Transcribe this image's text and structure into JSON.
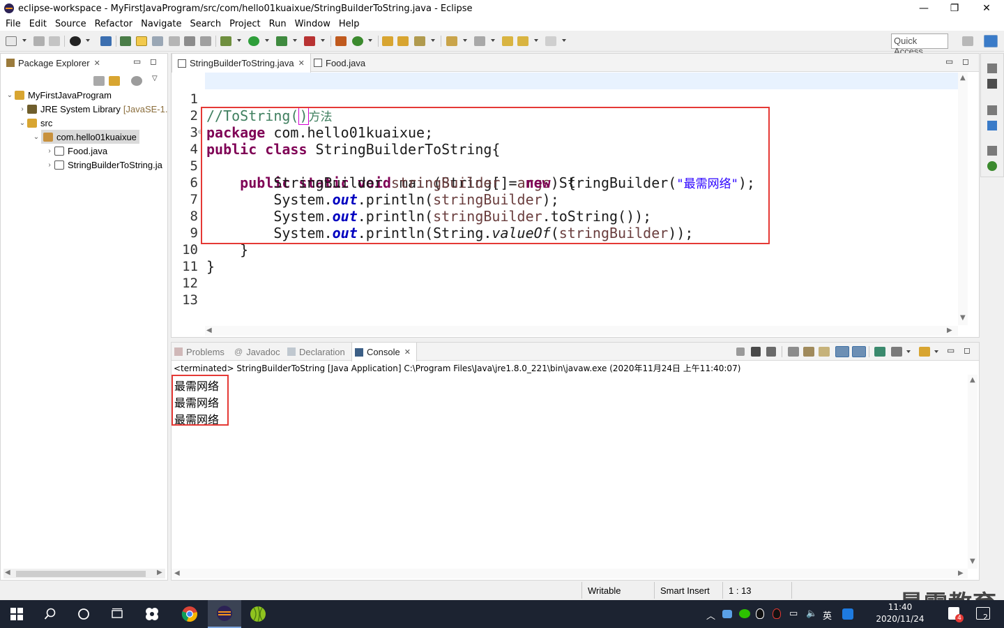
{
  "window": {
    "title": "eclipse-workspace - MyFirstJavaProgram/src/com/hello01kuaixue/StringBuilderToString.java - Eclipse",
    "minimize": "—",
    "maximize": "❐",
    "close": "✕"
  },
  "menu": [
    "File",
    "Edit",
    "Source",
    "Refactor",
    "Navigate",
    "Search",
    "Project",
    "Run",
    "Window",
    "Help"
  ],
  "toolbar": {
    "quick_access": "Quick Access"
  },
  "package_explorer": {
    "tab_label": "Package Explorer",
    "tab_close": "✕",
    "tree": [
      {
        "label": "MyFirstJavaProgram",
        "suffix": "",
        "arrow": "⌄"
      },
      {
        "label": "JRE System Library",
        "suffix": "[JavaSE-1.",
        "arrow": "›"
      },
      {
        "label": "src",
        "suffix": "",
        "arrow": "⌄"
      },
      {
        "label": "com.hello01kuaixue",
        "suffix": "",
        "arrow": "⌄"
      },
      {
        "label": "Food.java",
        "suffix": "",
        "arrow": "›"
      },
      {
        "label": "StringBuilderToString.ja",
        "suffix": "",
        "arrow": "›"
      }
    ]
  },
  "editor": {
    "tabs": [
      {
        "label": "StringBuilderToString.java",
        "close": "✕"
      },
      {
        "label": "Food.java",
        "close": ""
      }
    ],
    "line_numbers": [
      "1",
      "2",
      "3",
      "4",
      "5",
      "6",
      "7",
      "8",
      "9",
      "10",
      "11",
      "12",
      "13"
    ],
    "code": {
      "l1_comment_a": "//ToString(",
      "l1_comment_b": ")",
      "l1_comment_c": "方法",
      "l2_kw": "package",
      "l2_rest": " com.hello01kuaixue;",
      "l3_kw1": "public",
      "l3_kw2": "class",
      "l3_rest": " StringBuilderToString{",
      "l4_kw1": "public",
      "l4_kw2": "static",
      "l4_kw3": "void",
      "l4_a": " main(String[] ",
      "l4_var": "args",
      "l4_b": ") {",
      "l5_a": "StringBuilder ",
      "l5_var": "stringBuilder",
      "l5_b": " = ",
      "l5_kw": "new",
      "l5_c": " StringBuilder(",
      "l5_str": "\"最需网络\"",
      "l5_d": ");",
      "l6_a": "System.",
      "l6_fld": "out",
      "l6_b": ".println(",
      "l6_var": "stringBuilder",
      "l6_c": ");",
      "l7_a": "System.",
      "l7_fld": "out",
      "l7_b": ".println(",
      "l7_var": "stringBuilder",
      "l7_c": ".toString());",
      "l8_a": "System.",
      "l8_fld": "out",
      "l8_b": ".println(String.",
      "l8_itl": "valueOf",
      "l8_c": "(",
      "l8_var": "stringBuilder",
      "l8_d": "));",
      "l9": "}",
      "l10": "}"
    }
  },
  "bottom": {
    "tabs": [
      {
        "label": "Problems"
      },
      {
        "label": "Javadoc"
      },
      {
        "label": "Declaration"
      },
      {
        "label": "Console",
        "close": "✕"
      }
    ],
    "console_header": "<terminated> StringBuilderToString [Java Application] C:\\Program Files\\Java\\jre1.8.0_221\\bin\\javaw.exe (2020年11月24日 上午11:40:07)",
    "console_output": [
      "最需网络",
      "最需网络",
      "最需网络"
    ]
  },
  "statusbar": {
    "writable": "Writable",
    "insert_mode": "Smart Insert",
    "position": "1 : 13"
  },
  "taskbar": {
    "time": "11:40",
    "date": "2020/11/24",
    "ime": "英",
    "notif_count": "2",
    "badge": "4"
  },
  "watermark": "最需教育",
  "colors": {
    "keyword": "#7f0055",
    "comment": "#3f7f5f",
    "string": "#2a00ff",
    "field": "#0000c0",
    "highlight_box": "#e53935"
  }
}
